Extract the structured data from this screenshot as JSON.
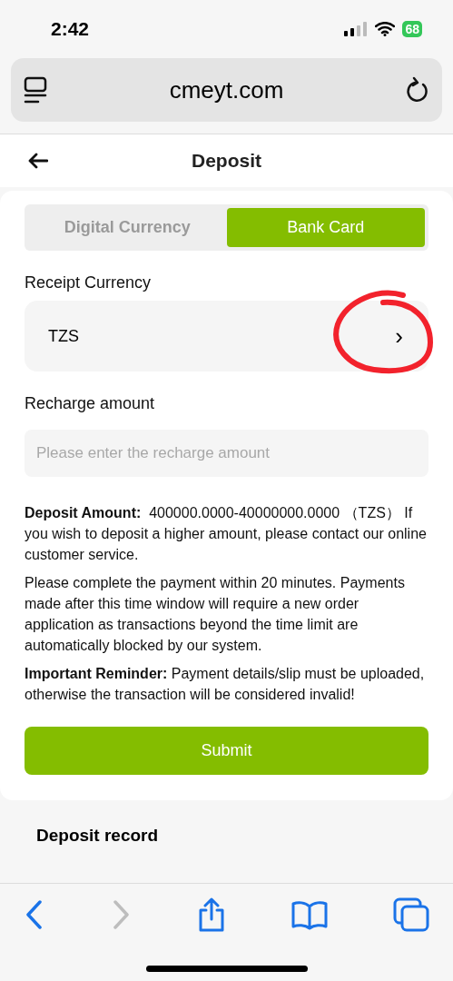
{
  "status_bar": {
    "time": "2:42",
    "battery": "68"
  },
  "browser": {
    "url": "cmeyt.com"
  },
  "header": {
    "title": "Deposit"
  },
  "tabs": [
    {
      "label": "Digital Currency",
      "selected": false
    },
    {
      "label": "Bank Card",
      "selected": true
    }
  ],
  "receipt_currency": {
    "label": "Receipt Currency",
    "value": "TZS",
    "chevron": "›"
  },
  "recharge_amount": {
    "label": "Recharge amount",
    "placeholder": "Please enter the recharge amount"
  },
  "notes": [
    "**Deposit Amount:**  400000.0000-40000000.0000 （TZS） If you wish to deposit a higher amount, please contact our online customer service.",
    "Please complete the payment within 20 minutes. Payments made after this time window will require a new order application as transactions beyond the time limit are automatically blocked by our system.",
    "**Important Reminder:** Payment details/slip must be uploaded, otherwise the transaction will be considered invalid!"
  ],
  "submit": "Submit",
  "deposit_record": {
    "title": "Deposit record"
  },
  "toolbar": {
    "forward_disabled": true
  }
}
